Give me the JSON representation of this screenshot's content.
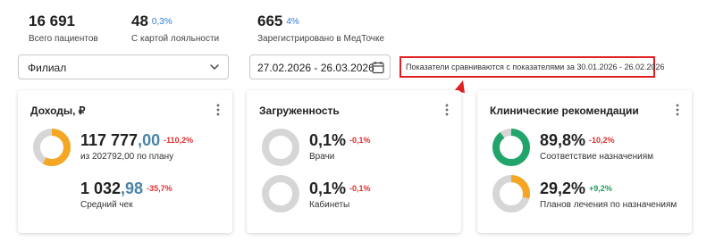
{
  "stats": [
    {
      "value": "16 691",
      "pct": "",
      "caption": "Всего пациентов"
    },
    {
      "value": "48",
      "pct": "0,3%",
      "caption": "С картой лояльности"
    },
    {
      "value": "665",
      "pct": "4%",
      "caption": "Зарегистрировано в МедТочке"
    }
  ],
  "filters": {
    "branch_label": "Филиал",
    "date_range": "27.02.2026 - 26.03.2026",
    "comparison_note": "Показатели сравниваются с показателями за 30.01.2026 - 26.02.2026"
  },
  "cards": {
    "income": {
      "title": "Доходы, ₽",
      "revenue": {
        "int": "117 777",
        "dec": ",00",
        "delta": "-110,2%",
        "caption": "из 202792,00 по плану",
        "ring_fraction": 0.58
      },
      "avg_check": {
        "int": "1 032",
        "dec": ",98",
        "delta": "-35,7%",
        "caption": "Средний чек"
      }
    },
    "load": {
      "title": "Загруженность",
      "doctors": {
        "value": "0,1%",
        "delta": "-0,1%",
        "caption": "Врачи",
        "ring_fraction": 0.001
      },
      "rooms": {
        "value": "0,1%",
        "delta": "-0,1%",
        "caption": "Кабинеты",
        "ring_fraction": 0.001
      }
    },
    "clinical": {
      "title": "Клинические рекомендации",
      "compliance": {
        "value": "89,8%",
        "delta": "-10,2%",
        "caption": "Соответствие назначениям",
        "ring_fraction": 0.898
      },
      "treatment": {
        "value": "29,2%",
        "delta": "+9,2%",
        "caption": "Планов лечения по назначениям",
        "ring_fraction": 0.292
      }
    }
  },
  "colors": {
    "accent_blue": "#2f7bd8",
    "orange": "#f5a623",
    "green": "#22a56a",
    "ring_track": "#d6d6d6",
    "negative": "#e02f2f",
    "positive": "#1e9e5a",
    "highlight": "#e02020"
  },
  "icons": [
    "chevron-down-icon",
    "calendar-icon",
    "kebab-menu-icon"
  ]
}
